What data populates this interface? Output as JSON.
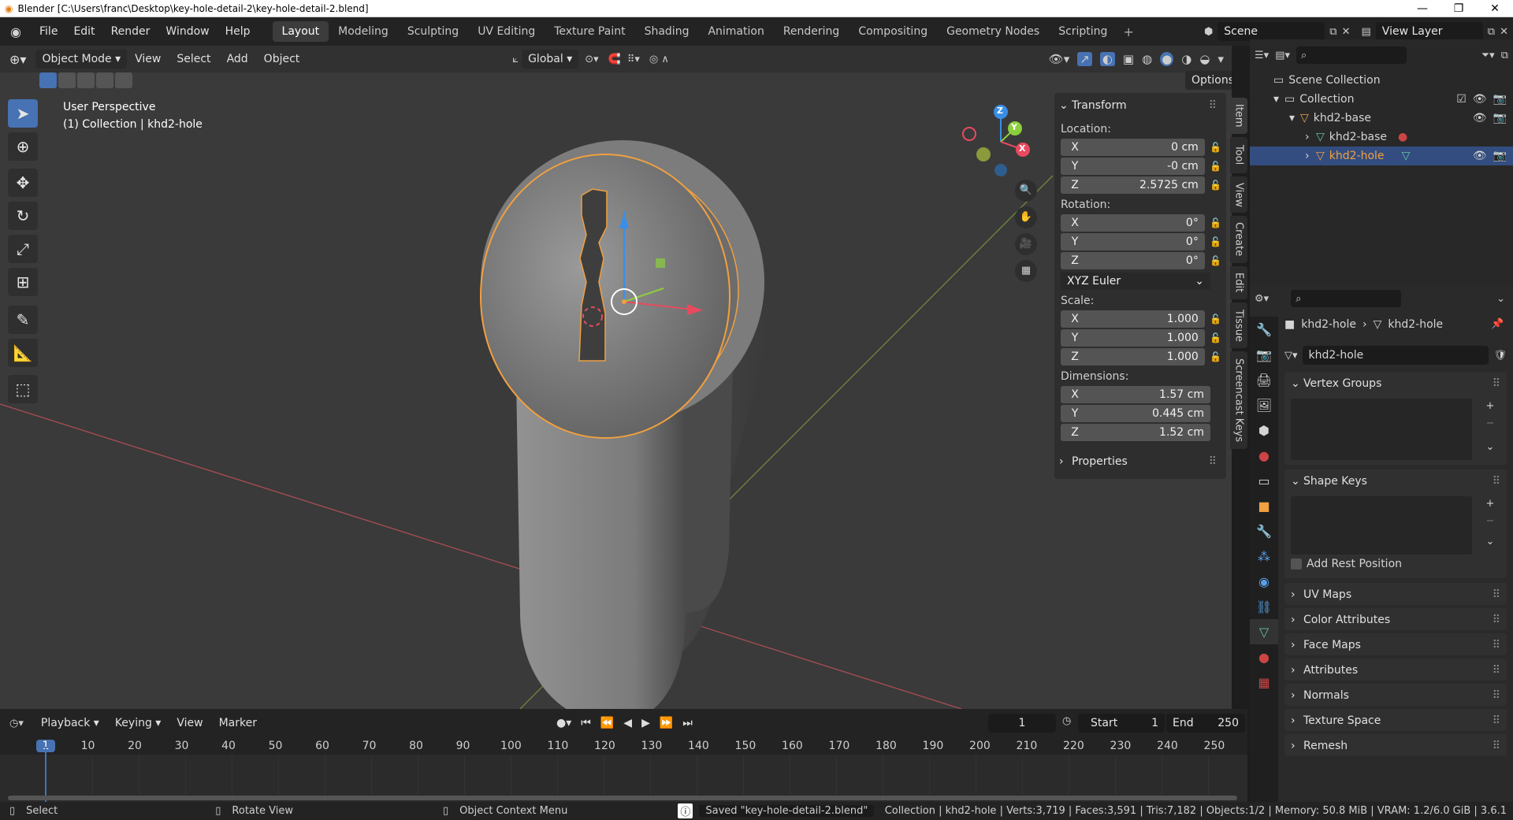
{
  "window": {
    "title": "Blender [C:\\Users\\franc\\Desktop\\key-hole-detail-2\\key-hole-detail-2.blend]",
    "controls": [
      "—",
      "❐",
      "✕"
    ]
  },
  "menu": [
    "File",
    "Edit",
    "Render",
    "Window",
    "Help"
  ],
  "workspaces": [
    "Layout",
    "Modeling",
    "Sculpting",
    "UV Editing",
    "Texture Paint",
    "Shading",
    "Animation",
    "Rendering",
    "Compositing",
    "Geometry Nodes",
    "Scripting"
  ],
  "active_workspace": "Layout",
  "scene": {
    "label": "Scene",
    "view_layer": "View Layer"
  },
  "viewport": {
    "mode": "Object Mode",
    "menus": [
      "View",
      "Select",
      "Add",
      "Object"
    ],
    "orientation": "Global",
    "options_label": "Options",
    "overlay_title": "User Perspective",
    "overlay_subtitle": "(1) Collection | khd2-hole",
    "gizmo_axes": [
      "Z",
      "Y",
      "X"
    ]
  },
  "npanel": {
    "transform_title": "Transform",
    "location_label": "Location:",
    "location": [
      {
        "axis": "X",
        "value": "0 cm"
      },
      {
        "axis": "Y",
        "value": "-0 cm"
      },
      {
        "axis": "Z",
        "value": "2.5725 cm"
      }
    ],
    "rotation_label": "Rotation:",
    "rotation": [
      {
        "axis": "X",
        "value": "0°"
      },
      {
        "axis": "Y",
        "value": "0°"
      },
      {
        "axis": "Z",
        "value": "0°"
      }
    ],
    "rotation_mode": "XYZ Euler",
    "scale_label": "Scale:",
    "scale": [
      {
        "axis": "X",
        "value": "1.000"
      },
      {
        "axis": "Y",
        "value": "1.000"
      },
      {
        "axis": "Z",
        "value": "1.000"
      }
    ],
    "dimensions_label": "Dimensions:",
    "dimensions": [
      {
        "axis": "X",
        "value": "1.57 cm"
      },
      {
        "axis": "Y",
        "value": "0.445 cm"
      },
      {
        "axis": "Z",
        "value": "1.52 cm"
      }
    ],
    "properties_title": "Properties",
    "tabs": [
      "Item",
      "Tool",
      "View",
      "Create",
      "Edit",
      "Tissue",
      "Screencast Keys"
    ]
  },
  "outliner": {
    "rows": [
      "Scene Collection",
      "Collection",
      "khd2-base",
      "khd2-base",
      "khd2-hole"
    ]
  },
  "properties": {
    "breadcrumb_object": "khd2-hole",
    "breadcrumb_data": "khd2-hole",
    "mesh_name": "khd2-hole",
    "vertex_groups": "Vertex Groups",
    "shape_keys": "Shape Keys",
    "add_rest_position": "Add Rest Position",
    "collapsed_panels": [
      "UV Maps",
      "Color Attributes",
      "Face Maps",
      "Attributes",
      "Normals",
      "Texture Space",
      "Remesh"
    ]
  },
  "timeline": {
    "menus": [
      "Playback",
      "Keying",
      "View",
      "Marker"
    ],
    "current_frame": "1",
    "start_label": "Start",
    "start": "1",
    "end_label": "End",
    "end": "250",
    "ruler": [
      "1",
      "10",
      "20",
      "30",
      "40",
      "50",
      "60",
      "70",
      "80",
      "90",
      "100",
      "110",
      "120",
      "130",
      "140",
      "150",
      "160",
      "170",
      "180",
      "190",
      "200",
      "210",
      "220",
      "230",
      "240",
      "250"
    ]
  },
  "status": {
    "select": "Select",
    "rotate": "Rotate View",
    "context": "Object Context Menu",
    "saved": "Saved \"key-hole-detail-2.blend\"",
    "stats": "Collection | khd2-hole | Verts:3,719 | Faces:3,591 | Tris:7,182 | Objects:1/2 | Memory: 50.8 MiB | VRAM: 1.2/6.0 GiB | 3.6.1"
  },
  "colors": {
    "accent": "#4772b3",
    "selection": "#f0a040",
    "x_axis": "#e84a5f",
    "y_axis": "#8ccf3c",
    "z_axis": "#3a8ee6"
  }
}
